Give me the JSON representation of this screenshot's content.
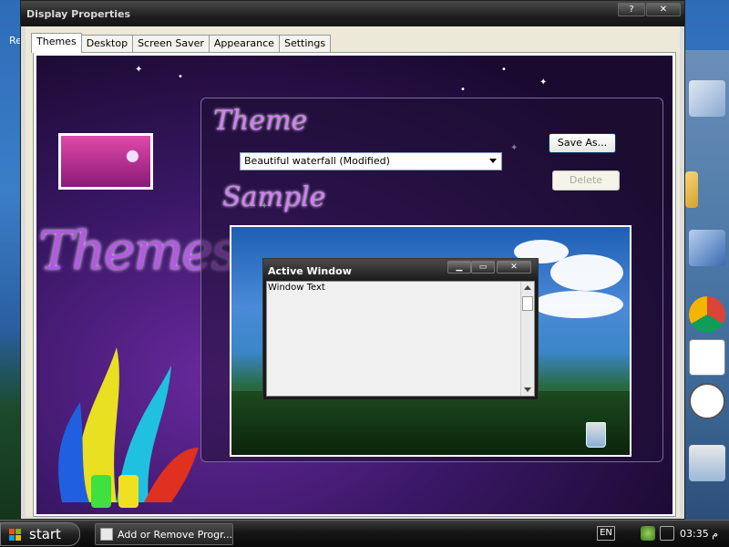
{
  "window": {
    "title": "Display Properties",
    "help_button": "?",
    "close_button": "✕"
  },
  "tabs": [
    {
      "label": "Themes",
      "active": true
    },
    {
      "label": "Desktop",
      "active": false
    },
    {
      "label": "Screen Saver",
      "active": false
    },
    {
      "label": "Appearance",
      "active": false
    },
    {
      "label": "Settings",
      "active": false
    }
  ],
  "themes_panel": {
    "banner_heading": "Themes",
    "theme_label": "Theme",
    "theme_select_value": "Beautiful waterfall (Modified)",
    "save_as_button": "Save As...",
    "delete_button": "Delete",
    "sample_label": "Sample"
  },
  "sample_window": {
    "title": "Active Window",
    "minimize": "▁",
    "maximize": "▭",
    "close": "✕",
    "body_text": "Window Text"
  },
  "desktop": {
    "left_fragment": "Re"
  },
  "taskbar": {
    "start_label": "start",
    "task_item": "Add or Remove Progr...",
    "language": "EN",
    "clock": "03:35 م"
  },
  "colors": {
    "accent_purple": "#b45ae0",
    "theme_bg": "#3a1766",
    "taskbar": "#151515"
  }
}
